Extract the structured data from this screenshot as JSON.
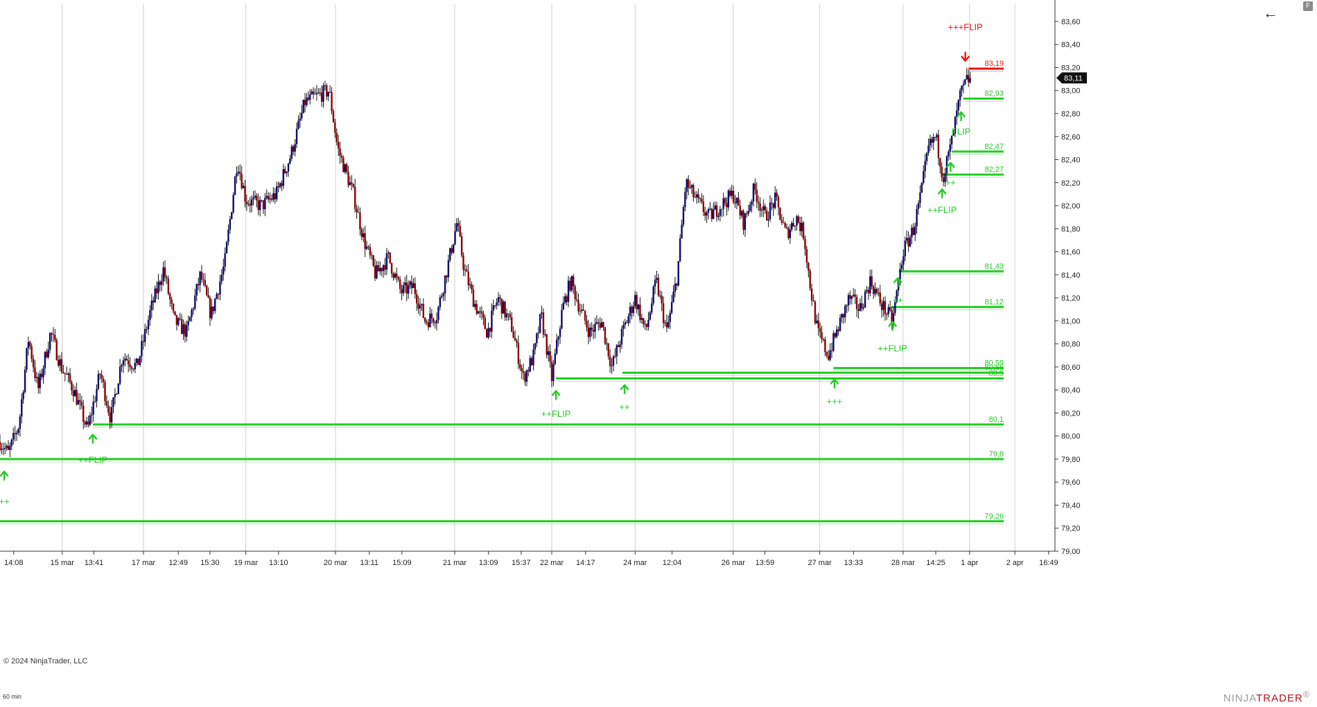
{
  "toolbar": {
    "corner_label": "F",
    "back_icon": "arrow-left-icon"
  },
  "footer": {
    "copyright": "© 2024 NinjaTrader, LLC",
    "interval": "60 min",
    "logo_prefix": "NINJA",
    "logo_suffix": "TRADER",
    "logo_mark": "®"
  },
  "colors": {
    "support": "#22cc22",
    "resistance": "#ee1111",
    "bull_candle": "#0a0a6e",
    "bear_candle": "#8b0000",
    "grid": "#cfcfcf",
    "price_tag_bg": "#111111"
  },
  "chart_data": {
    "type": "candlestick",
    "ylim": [
      79.0,
      83.75
    ],
    "y_ticks": [
      "83,60",
      "83,40",
      "83,20",
      "83,00",
      "82,80",
      "82,60",
      "82,40",
      "82,20",
      "82,00",
      "81,80",
      "81,60",
      "81,40",
      "81,20",
      "81,00",
      "80,80",
      "80,60",
      "80,40",
      "80,20",
      "80,00",
      "79,80",
      "79,60",
      "79,40",
      "79,20",
      "79,00"
    ],
    "y_tick_values": [
      83.6,
      83.4,
      83.2,
      83.0,
      82.8,
      82.6,
      82.4,
      82.2,
      82.0,
      81.8,
      81.6,
      81.4,
      81.2,
      81.0,
      80.8,
      80.6,
      80.4,
      80.2,
      80.0,
      79.8,
      79.6,
      79.4,
      79.2,
      79.0
    ],
    "x_ticks": [
      "14:08",
      "15 mar",
      "13:41",
      "17 mar",
      "12:49",
      "15:30",
      "19 mar",
      "13:10",
      "20 mar",
      "13:11",
      "15:09",
      "21 mar",
      "13:09",
      "15:37",
      "22 mar",
      "14:17",
      "24 mar",
      "12:04",
      "26 mar",
      "13:59",
      "27 mar",
      "13:33",
      "28 mar",
      "14:25",
      "1 apr",
      "2 apr",
      "16:49"
    ],
    "x_tick_positions": [
      0.013,
      0.059,
      0.089,
      0.136,
      0.169,
      0.199,
      0.233,
      0.264,
      0.318,
      0.35,
      0.381,
      0.431,
      0.463,
      0.494,
      0.523,
      0.555,
      0.602,
      0.637,
      0.695,
      0.725,
      0.777,
      0.809,
      0.856,
      0.887,
      0.919,
      0.962,
      0.994
    ],
    "day_separators": [
      0.059,
      0.136,
      0.233,
      0.318,
      0.431,
      0.523,
      0.602,
      0.695,
      0.777,
      0.856,
      0.919,
      0.962
    ],
    "current_price": 83.11,
    "current_price_label": "83,11",
    "path_waypoints": [
      [
        0.0,
        79.95
      ],
      [
        0.008,
        79.85
      ],
      [
        0.018,
        80.1
      ],
      [
        0.027,
        80.85
      ],
      [
        0.036,
        80.4
      ],
      [
        0.048,
        80.9
      ],
      [
        0.058,
        80.6
      ],
      [
        0.07,
        80.4
      ],
      [
        0.083,
        80.05
      ],
      [
        0.095,
        80.55
      ],
      [
        0.105,
        80.15
      ],
      [
        0.116,
        80.7
      ],
      [
        0.13,
        80.6
      ],
      [
        0.143,
        81.1
      ],
      [
        0.155,
        81.45
      ],
      [
        0.165,
        81.0
      ],
      [
        0.177,
        80.9
      ],
      [
        0.19,
        81.4
      ],
      [
        0.2,
        81.05
      ],
      [
        0.213,
        81.5
      ],
      [
        0.225,
        82.4
      ],
      [
        0.233,
        82.05
      ],
      [
        0.248,
        82.0
      ],
      [
        0.262,
        82.1
      ],
      [
        0.276,
        82.45
      ],
      [
        0.289,
        82.9
      ],
      [
        0.3,
        82.95
      ],
      [
        0.312,
        83.0
      ],
      [
        0.32,
        82.5
      ],
      [
        0.335,
        82.1
      ],
      [
        0.345,
        81.7
      ],
      [
        0.356,
        81.4
      ],
      [
        0.368,
        81.55
      ],
      [
        0.38,
        81.25
      ],
      [
        0.392,
        81.3
      ],
      [
        0.403,
        81.0
      ],
      [
        0.414,
        81.05
      ],
      [
        0.425,
        81.5
      ],
      [
        0.433,
        81.85
      ],
      [
        0.44,
        81.45
      ],
      [
        0.45,
        81.15
      ],
      [
        0.462,
        80.9
      ],
      [
        0.472,
        81.2
      ],
      [
        0.485,
        80.95
      ],
      [
        0.496,
        80.5
      ],
      [
        0.506,
        80.7
      ],
      [
        0.513,
        81.05
      ],
      [
        0.523,
        80.5
      ],
      [
        0.533,
        81.1
      ],
      [
        0.541,
        81.35
      ],
      [
        0.55,
        81.1
      ],
      [
        0.559,
        80.9
      ],
      [
        0.57,
        81.0
      ],
      [
        0.58,
        80.6
      ],
      [
        0.59,
        80.9
      ],
      [
        0.602,
        81.2
      ],
      [
        0.612,
        80.9
      ],
      [
        0.622,
        81.35
      ],
      [
        0.632,
        80.9
      ],
      [
        0.642,
        81.4
      ],
      [
        0.65,
        82.2
      ],
      [
        0.66,
        82.05
      ],
      [
        0.672,
        81.9
      ],
      [
        0.683,
        82.0
      ],
      [
        0.695,
        82.1
      ],
      [
        0.705,
        81.85
      ],
      [
        0.715,
        82.15
      ],
      [
        0.725,
        81.9
      ],
      [
        0.735,
        82.05
      ],
      [
        0.745,
        81.75
      ],
      [
        0.755,
        81.9
      ],
      [
        0.762,
        81.75
      ],
      [
        0.768,
        81.3
      ],
      [
        0.775,
        80.9
      ],
      [
        0.785,
        80.7
      ],
      [
        0.795,
        80.95
      ],
      [
        0.805,
        81.2
      ],
      [
        0.815,
        81.1
      ],
      [
        0.825,
        81.35
      ],
      [
        0.835,
        81.15
      ],
      [
        0.846,
        81.0
      ],
      [
        0.856,
        81.6
      ],
      [
        0.866,
        81.8
      ],
      [
        0.873,
        82.1
      ],
      [
        0.88,
        82.5
      ],
      [
        0.887,
        82.6
      ],
      [
        0.894,
        82.25
      ],
      [
        0.902,
        82.55
      ],
      [
        0.91,
        82.95
      ],
      [
        0.917,
        83.1
      ],
      [
        0.921,
        83.08
      ]
    ],
    "levels": [
      {
        "label": "83,19",
        "value": 83.19,
        "start": 0.918,
        "kind": "resistance"
      },
      {
        "label": "82,93",
        "value": 82.93,
        "start": 0.913,
        "kind": "support"
      },
      {
        "label": "82,47",
        "value": 82.47,
        "start": 0.902,
        "kind": "support"
      },
      {
        "label": "82,27",
        "value": 82.27,
        "start": 0.893,
        "kind": "support"
      },
      {
        "label": "81,43",
        "value": 81.43,
        "start": 0.852,
        "kind": "support"
      },
      {
        "label": "81,12",
        "value": 81.12,
        "start": 0.845,
        "kind": "support"
      },
      {
        "label": "80,59",
        "value": 80.59,
        "start": 0.79,
        "kind": "support"
      },
      {
        "label": "80,55",
        "value": 80.55,
        "start": 0.59,
        "kind": "support"
      },
      {
        "label": "80,5",
        "value": 80.5,
        "start": 0.527,
        "kind": "support"
      },
      {
        "label": "80,1",
        "value": 80.1,
        "start": 0.088,
        "kind": "support"
      },
      {
        "label": "79,8",
        "value": 79.8,
        "start": 0.0,
        "kind": "support"
      },
      {
        "label": "79,26",
        "value": 79.26,
        "start": 0.0,
        "kind": "support"
      }
    ],
    "signals": [
      {
        "x": 0.004,
        "arrow_y": 79.65,
        "text": "++",
        "text_y": 79.43,
        "dir": "up",
        "kind": "support"
      },
      {
        "x": 0.088,
        "arrow_y": 79.97,
        "text": "++FLIP",
        "text_y": 79.79,
        "dir": "up",
        "kind": "support"
      },
      {
        "x": 0.527,
        "arrow_y": 80.35,
        "text": "++FLIP",
        "text_y": 80.19,
        "dir": "up",
        "kind": "support"
      },
      {
        "x": 0.592,
        "arrow_y": 80.4,
        "text": "++",
        "text_y": 80.25,
        "dir": "up",
        "kind": "support"
      },
      {
        "x": 0.791,
        "arrow_y": 80.45,
        "text": "+++",
        "text_y": 80.3,
        "dir": "up",
        "kind": "support"
      },
      {
        "x": 0.846,
        "arrow_y": 80.95,
        "text": "++FLIP",
        "text_y": 80.76,
        "dir": "up",
        "kind": "support"
      },
      {
        "x": 0.851,
        "arrow_y": 81.33,
        "text": "++",
        "text_y": 81.18,
        "dir": "up",
        "kind": "support"
      },
      {
        "x": 0.893,
        "arrow_y": 82.1,
        "text": "++FLIP",
        "text_y": 81.96,
        "dir": "up",
        "kind": "support"
      },
      {
        "x": 0.901,
        "arrow_y": 82.33,
        "text": "++",
        "text_y": 82.2,
        "dir": "up",
        "kind": "support"
      },
      {
        "x": 0.911,
        "arrow_y": 82.77,
        "text": "FLIP",
        "text_y": 82.64,
        "dir": "up",
        "kind": "support"
      },
      {
        "x": 0.915,
        "arrow_y": 83.3,
        "text": "+++FLIP",
        "text_y": 83.55,
        "dir": "down",
        "kind": "resistance"
      }
    ]
  }
}
